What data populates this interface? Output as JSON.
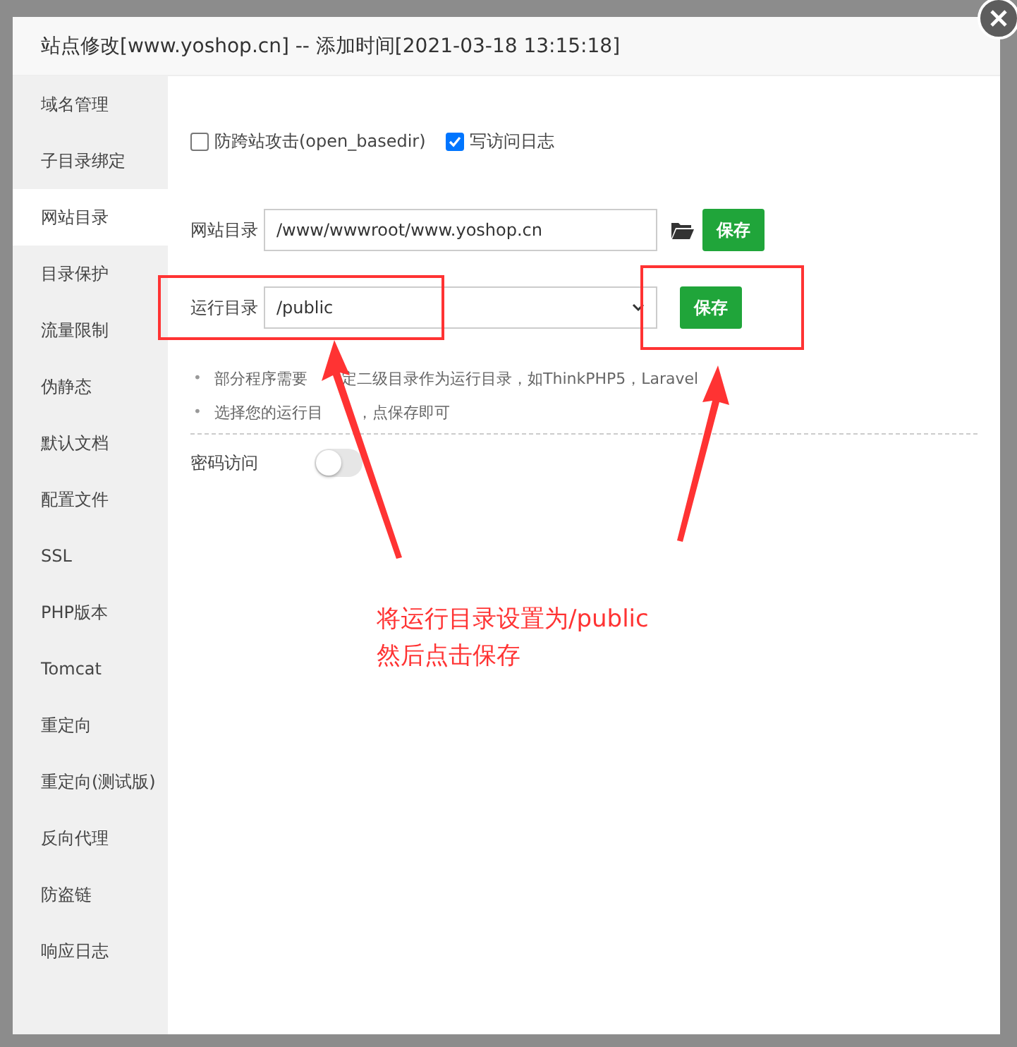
{
  "dialog": {
    "title": "站点修改[www.yoshop.cn] -- 添加时间[2021-03-18 13:15:18]"
  },
  "sidebar": {
    "items": [
      {
        "label": "域名管理",
        "selected": false
      },
      {
        "label": "子目录绑定",
        "selected": false
      },
      {
        "label": "网站目录",
        "selected": true
      },
      {
        "label": "目录保护",
        "selected": false
      },
      {
        "label": "流量限制",
        "selected": false
      },
      {
        "label": "伪静态",
        "selected": false
      },
      {
        "label": "默认文档",
        "selected": false
      },
      {
        "label": "配置文件",
        "selected": false
      },
      {
        "label": "SSL",
        "selected": false
      },
      {
        "label": "PHP版本",
        "selected": false
      },
      {
        "label": "Tomcat",
        "selected": false
      },
      {
        "label": "重定向",
        "selected": false
      },
      {
        "label": "重定向(测试版)",
        "selected": false
      },
      {
        "label": "反向代理",
        "selected": false
      },
      {
        "label": "防盗链",
        "selected": false
      },
      {
        "label": "响应日志",
        "selected": false
      }
    ]
  },
  "options": [
    {
      "label": "防跨站攻击(open_basedir)",
      "checked": false
    },
    {
      "label": "写访问日志",
      "checked": true
    }
  ],
  "site_dir": {
    "label": "网站目录",
    "value": "/www/wwwroot/www.yoshop.cn",
    "button": "保存"
  },
  "run_dir": {
    "label": "运行目录",
    "value": "/public",
    "button": "保存"
  },
  "hints": [
    {
      "bullet": "•",
      "parts": [
        "部分程序需要",
        "定二级目录作为运行目录，如ThinkPHP5，Laravel"
      ]
    },
    {
      "bullet": "•",
      "parts": [
        "选择您的运行目",
        "，点保存即可"
      ]
    }
  ],
  "password_access": {
    "label": "密码访问",
    "on": false
  },
  "annotation": {
    "lines": [
      "将运行目录设置为/public",
      "然后点击保存"
    ]
  }
}
